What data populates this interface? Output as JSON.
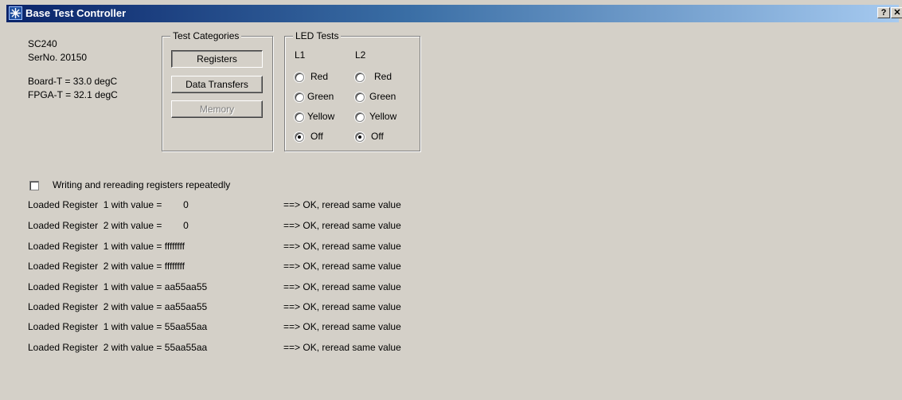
{
  "window": {
    "title": "Base Test Controller",
    "help_label": "?",
    "close_label": "✕"
  },
  "device": {
    "model": "SC240",
    "serial": "SerNo. 20150",
    "board_temp": "Board-T =  33.0 degC",
    "fpga_temp": "FPGA-T =  32.1 degC"
  },
  "test_categories": {
    "legend": "Test Categories",
    "buttons": [
      "Registers",
      "Data Transfers",
      "Memory"
    ]
  },
  "led_tests": {
    "legend": "LED Tests",
    "columns": [
      "L1",
      "L2"
    ],
    "options": [
      "Red",
      "Green",
      "Yellow",
      "Off"
    ],
    "selected": "Off"
  },
  "repeat": {
    "label": "Writing and rereading registers repeatedly",
    "checked": false
  },
  "log": [
    {
      "left": "Loaded Register  1 with value =        0",
      "right": "==> OK, reread same value"
    },
    {
      "left": "Loaded Register  2 with value =        0",
      "right": "==> OK, reread same value"
    },
    {
      "left": "Loaded Register  1 with value = ffffffff",
      "right": "==> OK, reread same value"
    },
    {
      "left": "Loaded Register  2 with value = ffffffff",
      "right": "==> OK, reread same value"
    },
    {
      "left": "Loaded Register  1 with value = aa55aa55",
      "right": "==> OK, reread same value"
    },
    {
      "left": "Loaded Register  2 with value = aa55aa55",
      "right": "==> OK, reread same value"
    },
    {
      "left": "Loaded Register  1 with value = 55aa55aa",
      "right": "==> OK, reread same value"
    },
    {
      "left": "Loaded Register  2 with value = 55aa55aa",
      "right": "==> OK, reread same value"
    }
  ],
  "colors": {
    "title_start": "#0a246a",
    "title_end": "#a6caf0",
    "face": "#d4d0c8"
  }
}
